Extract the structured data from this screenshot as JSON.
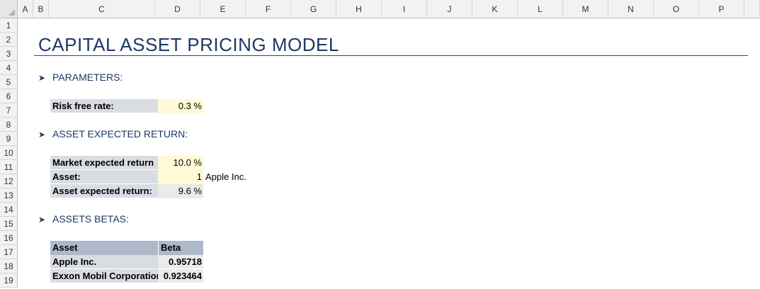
{
  "columns": [
    "A",
    "B",
    "C",
    "D",
    "E",
    "F",
    "G",
    "H",
    "I",
    "J",
    "K",
    "L",
    "M",
    "N",
    "O",
    "P"
  ],
  "rows": [
    "1",
    "2",
    "3",
    "4",
    "5",
    "6",
    "7",
    "8",
    "9",
    "10",
    "11",
    "12",
    "13",
    "14",
    "15",
    "16",
    "17",
    "18",
    "19"
  ],
  "title": "CAPITAL ASSET PRICING MODEL",
  "sections": {
    "parameters": "PARAMETERS:",
    "expected_return": "ASSET EXPECTED RETURN:",
    "betas": "ASSETS BETAS:"
  },
  "arrow_glyph": "➤",
  "parameters": {
    "risk_free_label": "Risk free rate:",
    "risk_free_value": "0.3 %"
  },
  "expected_return": {
    "market_label": "Market expected return",
    "market_value": "10.0 %",
    "asset_label": "Asset:",
    "asset_value": "1",
    "asset_name": "Apple Inc.",
    "asset_return_label": "Asset expected return:",
    "asset_return_value": "9.6 %"
  },
  "betas_table": {
    "headers": [
      "Asset",
      "Beta"
    ],
    "rows": [
      {
        "asset": "Apple Inc.",
        "beta": "0.95718"
      },
      {
        "asset": "Exxon Mobil Corporation",
        "beta": "0.923464"
      }
    ]
  },
  "colors": {
    "title": "#1f3864",
    "label_fill": "#d9dce3",
    "input_fill": "#fff9d6",
    "output_fill": "#eaeaea",
    "table_header_fill": "#adb9ca"
  }
}
